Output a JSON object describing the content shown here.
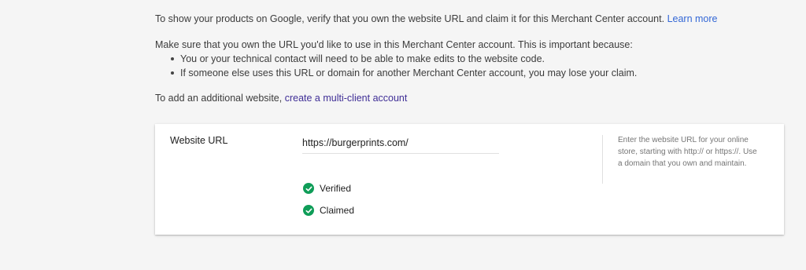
{
  "intro": {
    "line1_text": "To show your products on Google, verify that you own the website URL and claim it for this Merchant Center account.",
    "learn_more": "Learn more",
    "line2_text": "Make sure that you own the URL you'd like to use in this Merchant Center account. This is important because:",
    "reasons": [
      "You or your technical contact will need to be able to make edits to the website code.",
      "If someone else uses this URL or domain for another Merchant Center account, you may lose your claim."
    ],
    "line3_text": "To add an additional website,",
    "multi_client_link": "create a multi-client account"
  },
  "card": {
    "label": "Website URL",
    "url_value": "https://burgerprints.com/",
    "statuses": {
      "verified": "Verified",
      "claimed": "Claimed"
    },
    "help_text": "Enter the website URL for your online store, starting with http:// or https://. Use a domain that you own and maintain."
  },
  "colors": {
    "link": "#3367d6",
    "visited_link": "#3f2e96",
    "success": "#0f9d58",
    "background": "#f5f5f5"
  },
  "icons": {
    "status": "check-circle-icon"
  }
}
